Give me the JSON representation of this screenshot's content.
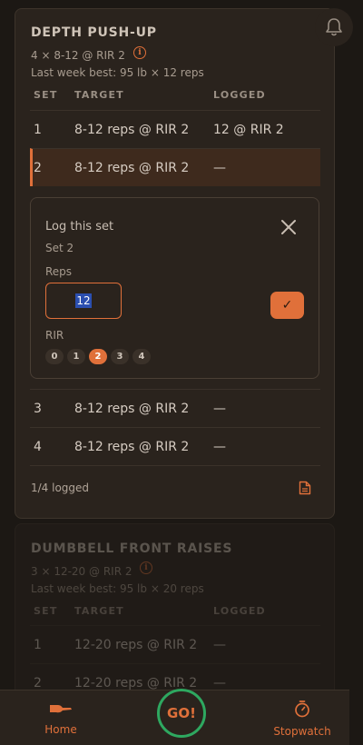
{
  "bell": {
    "icon": "bell-icon"
  },
  "exercise1": {
    "title": "DEPTH PUSH-UP",
    "scheme": "4 × 8-12 @ RIR 2",
    "best": "Last week best: 95 lb × 12 reps",
    "headers": {
      "set": "SET",
      "target": "TARGET",
      "logged": "LOGGED"
    },
    "rows": [
      {
        "set": "1",
        "target": "8-12 reps @ RIR 2",
        "logged": "12 @ RIR 2"
      },
      {
        "set": "2",
        "target": "8-12 reps @ RIR 2",
        "logged": "—"
      },
      {
        "set": "3",
        "target": "8-12 reps @ RIR 2",
        "logged": "—"
      },
      {
        "set": "4",
        "target": "8-12 reps @ RIR 2",
        "logged": "—"
      }
    ],
    "footer": "1/4 logged"
  },
  "log_panel": {
    "title": "Log this set",
    "set_label": "Set 2",
    "reps_label": "Reps",
    "reps_value": "12",
    "confirm": "✓",
    "rir_label": "RIR",
    "rir_options": [
      "0",
      "1",
      "2",
      "3",
      "4"
    ],
    "rir_selected": "2"
  },
  "exercise2": {
    "title": "DUMBBELL FRONT RAISES",
    "scheme": "3 × 12-20 @ RIR 2",
    "best": "Last week best: 95 lb × 20 reps",
    "headers": {
      "set": "SET",
      "target": "TARGET",
      "logged": "LOGGED"
    },
    "rows": [
      {
        "set": "1",
        "target": "12-20 reps @ RIR 2",
        "logged": "—"
      },
      {
        "set": "2",
        "target": "12-20 reps @ RIR 2",
        "logged": "—"
      }
    ]
  },
  "tabbar": {
    "home": "Home",
    "go": "GO!",
    "stopwatch": "Stopwatch"
  },
  "colors": {
    "accent": "#e0703a",
    "go_ring": "#2ea860",
    "bg": "#1c1814",
    "card": "#2a231d"
  }
}
